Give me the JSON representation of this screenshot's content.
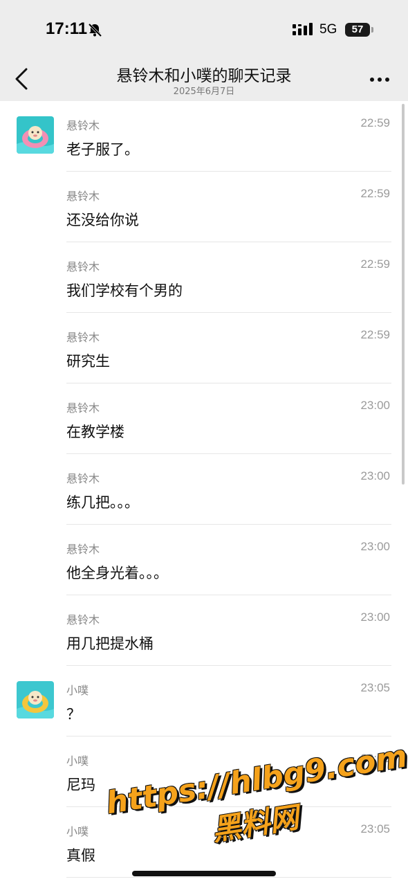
{
  "status_bar": {
    "time": "17:11",
    "network": "5G",
    "battery": "57"
  },
  "header": {
    "title": "悬铃木和小噗的聊天记录",
    "subtitle": "2025年6月7日"
  },
  "icons": {
    "back": "chevron-left-icon",
    "more": "more-dots-icon",
    "bell": "bell-mute-icon",
    "signal": "signal-icon"
  },
  "messages": [
    {
      "sender": "悬铃木",
      "time": "22:59",
      "text": "老子服了。",
      "avatar": true
    },
    {
      "sender": "悬铃木",
      "time": "22:59",
      "text": "还没给你说",
      "avatar": false
    },
    {
      "sender": "悬铃木",
      "time": "22:59",
      "text": "我们学校有个男的",
      "avatar": false
    },
    {
      "sender": "悬铃木",
      "time": "22:59",
      "text": "研究生",
      "avatar": false
    },
    {
      "sender": "悬铃木",
      "time": "23:00",
      "text": "在教学楼",
      "avatar": false
    },
    {
      "sender": "悬铃木",
      "time": "23:00",
      "text": "练几把。。。",
      "avatar": false
    },
    {
      "sender": "悬铃木",
      "time": "23:00",
      "text": "他全身光着。。。",
      "avatar": false
    },
    {
      "sender": "悬铃木",
      "time": "23:00",
      "text": "用几把提水桶",
      "avatar": false
    },
    {
      "sender": "小噗",
      "time": "23:05",
      "text": "？",
      "avatar": true
    },
    {
      "sender": "小噗",
      "time": "23:05",
      "text": "尼玛",
      "avatar": false
    },
    {
      "sender": "小噗",
      "time": "23:05",
      "text": "真假",
      "avatar": false
    }
  ],
  "watermark": {
    "line1": "https://hlbg9.com",
    "line2": "黑料网"
  }
}
